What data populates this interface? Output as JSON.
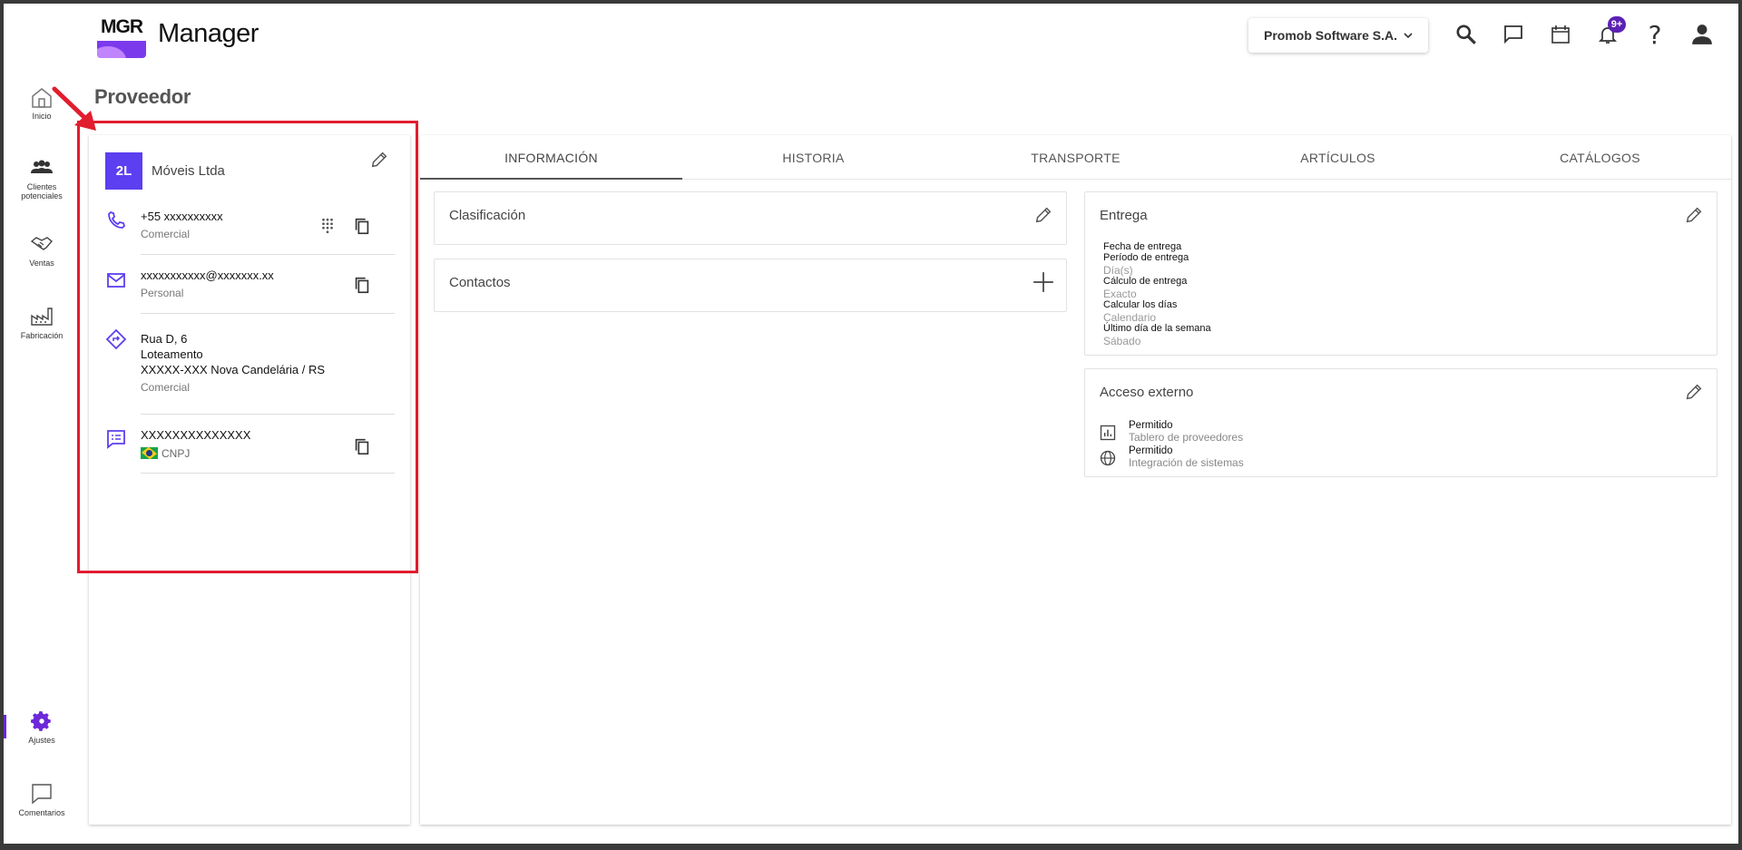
{
  "app": {
    "logo_text": "MGR",
    "name": "Manager"
  },
  "header": {
    "company": "Promob Software S.A.",
    "notifications_badge": "9+",
    "icons": [
      "search-icon",
      "chat-icon",
      "calendar-icon",
      "bell-icon",
      "help-icon",
      "account-icon"
    ]
  },
  "rail": {
    "items": [
      {
        "label": "Inicio",
        "icon": "home-icon"
      },
      {
        "label": "Clientes potenciales",
        "icon": "people-icon"
      },
      {
        "label": "Ventas",
        "icon": "handshake-icon"
      },
      {
        "label": "Fabricación",
        "icon": "factory-icon"
      },
      {
        "label": "Ajustes",
        "icon": "gear-icon",
        "active": true
      },
      {
        "label": "Comentarios",
        "icon": "comment-icon"
      }
    ],
    "accent": "#6d28d9"
  },
  "page": {
    "title": "Proveedor"
  },
  "supplier": {
    "initials": "2L",
    "name": "Móveis Ltda",
    "phone": {
      "value": "+55 xxxxxxxxxx",
      "type": "Comercial"
    },
    "email": {
      "value": "xxxxxxxxxxx@xxxxxxx.xx",
      "type": "Personal"
    },
    "address": {
      "line1": "Rua D, 6",
      "line2": "Loteamento",
      "line3": "XXXXX-XXX Nova Candelária / RS",
      "type": "Comercial"
    },
    "document": {
      "value": "XXXXXXXXXXXXXX",
      "type": "CNPJ"
    },
    "avatar_color": "#5b3ff1"
  },
  "tabs": [
    {
      "label": "INFORMACIÓN",
      "active": true
    },
    {
      "label": "HISTORIA"
    },
    {
      "label": "TRANSPORTE"
    },
    {
      "label": "ARTÍCULOS"
    },
    {
      "label": "CATÁLOGOS"
    }
  ],
  "panels": {
    "clasificacion": {
      "title": "Clasificación"
    },
    "contactos": {
      "title": "Contactos"
    },
    "entrega": {
      "title": "Entrega",
      "rows": [
        {
          "label": "Fecha de entrega",
          "value": ""
        },
        {
          "label": "Período de entrega",
          "value": "Día(s)"
        },
        {
          "label": "Cálculo de entrega",
          "value": "Exacto"
        },
        {
          "label": "Calcular los días",
          "value": "Calendario"
        },
        {
          "label": "Último día de la semana",
          "value": "Sábado"
        }
      ]
    },
    "acceso": {
      "title": "Acceso externo",
      "rows": [
        {
          "icon": "chart-icon",
          "status": "Permitido",
          "name": "Tablero de proveedores"
        },
        {
          "icon": "globe-icon",
          "status": "Permitido",
          "name": "Integración de sistemas"
        }
      ]
    }
  },
  "colors": {
    "highlight": "#e11d2e",
    "brand": "#7c3aed"
  }
}
